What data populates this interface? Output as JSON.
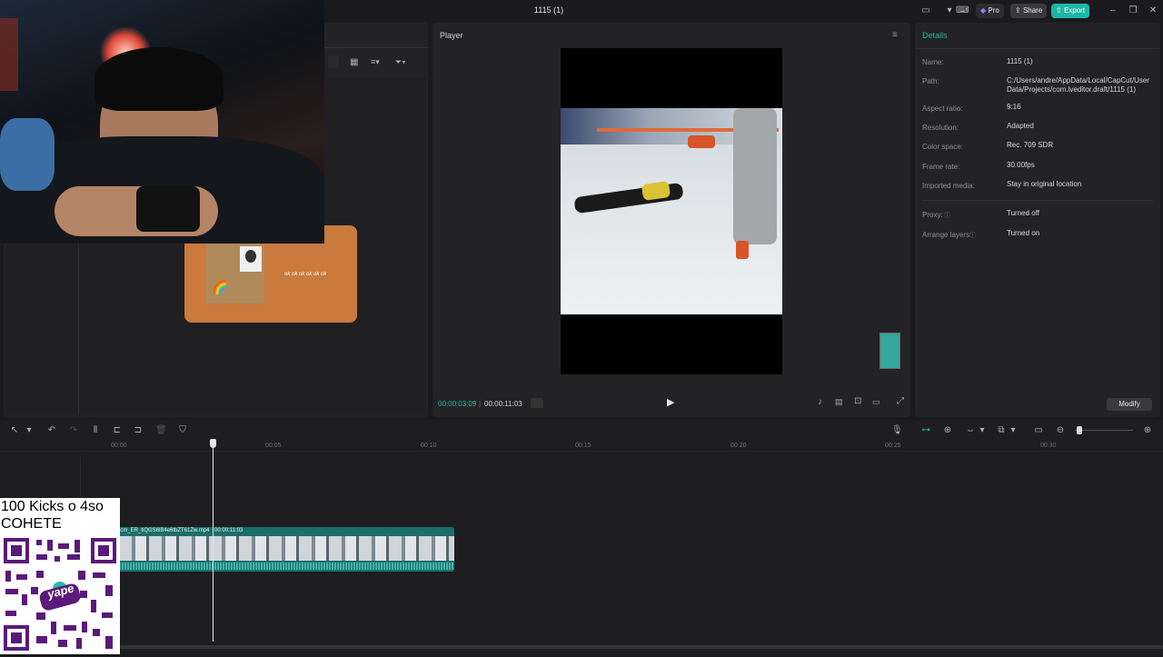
{
  "app": {
    "window_title": "1115 (1)",
    "pro_label": "Pro",
    "share_label": "Share",
    "export_label": "Export",
    "accent_color": "#1fb6a6"
  },
  "player": {
    "title": "Player",
    "current_time": "00:00:03:09",
    "total_time": "00:00:11:03"
  },
  "media": {
    "card_text": "ok ok ok ok ok ok"
  },
  "details": {
    "title": "Details",
    "rows": [
      {
        "label": "Name:",
        "value": "1115 (1)"
      },
      {
        "label": "Path:",
        "value": "C:/Users/andre/AppData/Local/CapCut/User Data/Projects/com.lveditor.draft/1115 (1)"
      },
      {
        "label": "Aspect ratio:",
        "value": "9:16"
      },
      {
        "label": "Resolution:",
        "value": "Adapted"
      },
      {
        "label": "Color space:",
        "value": "Rec. 709 SDR"
      },
      {
        "label": "Frame rate:",
        "value": "30.00fps"
      },
      {
        "label": "Imported media:",
        "value": "Stay in original location"
      },
      {
        "label": "Proxy:",
        "value": "Turned off"
      },
      {
        "label": "Arrange layers:",
        "value": "Turned on"
      }
    ],
    "modify_label": "Modify"
  },
  "timeline": {
    "ticks": [
      "00:00",
      "00:05",
      "00:10",
      "00:15",
      "00:20",
      "00:25",
      "00:30"
    ],
    "clip_label": "7-cm_ER_tiQGS6lB4e6tbZT61Zw.mp4",
    "clip_duration": "00:00:11:03"
  },
  "overlay": {
    "line1": "100 Kicks o 4so",
    "line2": "COHETE",
    "qr_brand": "yape"
  }
}
